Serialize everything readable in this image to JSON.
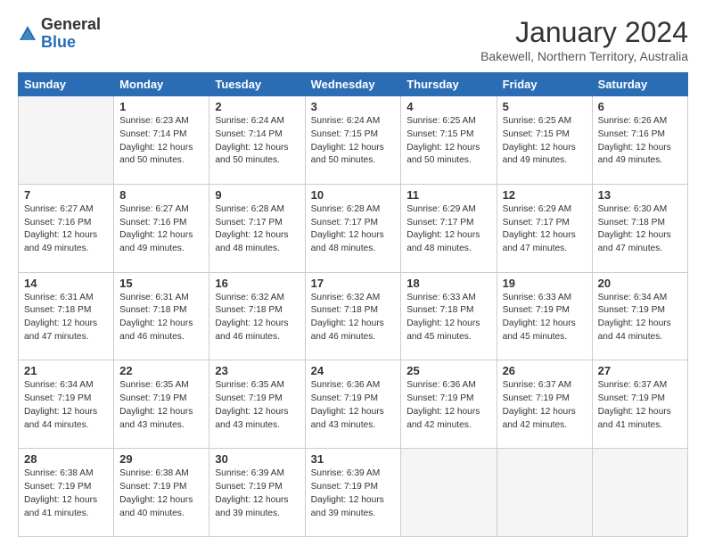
{
  "logo": {
    "general": "General",
    "blue": "Blue"
  },
  "header": {
    "month": "January 2024",
    "location": "Bakewell, Northern Territory, Australia"
  },
  "weekdays": [
    "Sunday",
    "Monday",
    "Tuesday",
    "Wednesday",
    "Thursday",
    "Friday",
    "Saturday"
  ],
  "weeks": [
    [
      {
        "day": "",
        "info": ""
      },
      {
        "day": "1",
        "info": "Sunrise: 6:23 AM\nSunset: 7:14 PM\nDaylight: 12 hours\nand 50 minutes."
      },
      {
        "day": "2",
        "info": "Sunrise: 6:24 AM\nSunset: 7:14 PM\nDaylight: 12 hours\nand 50 minutes."
      },
      {
        "day": "3",
        "info": "Sunrise: 6:24 AM\nSunset: 7:15 PM\nDaylight: 12 hours\nand 50 minutes."
      },
      {
        "day": "4",
        "info": "Sunrise: 6:25 AM\nSunset: 7:15 PM\nDaylight: 12 hours\nand 50 minutes."
      },
      {
        "day": "5",
        "info": "Sunrise: 6:25 AM\nSunset: 7:15 PM\nDaylight: 12 hours\nand 49 minutes."
      },
      {
        "day": "6",
        "info": "Sunrise: 6:26 AM\nSunset: 7:16 PM\nDaylight: 12 hours\nand 49 minutes."
      }
    ],
    [
      {
        "day": "7",
        "info": "Sunrise: 6:27 AM\nSunset: 7:16 PM\nDaylight: 12 hours\nand 49 minutes."
      },
      {
        "day": "8",
        "info": "Sunrise: 6:27 AM\nSunset: 7:16 PM\nDaylight: 12 hours\nand 49 minutes."
      },
      {
        "day": "9",
        "info": "Sunrise: 6:28 AM\nSunset: 7:17 PM\nDaylight: 12 hours\nand 48 minutes."
      },
      {
        "day": "10",
        "info": "Sunrise: 6:28 AM\nSunset: 7:17 PM\nDaylight: 12 hours\nand 48 minutes."
      },
      {
        "day": "11",
        "info": "Sunrise: 6:29 AM\nSunset: 7:17 PM\nDaylight: 12 hours\nand 48 minutes."
      },
      {
        "day": "12",
        "info": "Sunrise: 6:29 AM\nSunset: 7:17 PM\nDaylight: 12 hours\nand 47 minutes."
      },
      {
        "day": "13",
        "info": "Sunrise: 6:30 AM\nSunset: 7:18 PM\nDaylight: 12 hours\nand 47 minutes."
      }
    ],
    [
      {
        "day": "14",
        "info": "Sunrise: 6:31 AM\nSunset: 7:18 PM\nDaylight: 12 hours\nand 47 minutes."
      },
      {
        "day": "15",
        "info": "Sunrise: 6:31 AM\nSunset: 7:18 PM\nDaylight: 12 hours\nand 46 minutes."
      },
      {
        "day": "16",
        "info": "Sunrise: 6:32 AM\nSunset: 7:18 PM\nDaylight: 12 hours\nand 46 minutes."
      },
      {
        "day": "17",
        "info": "Sunrise: 6:32 AM\nSunset: 7:18 PM\nDaylight: 12 hours\nand 46 minutes."
      },
      {
        "day": "18",
        "info": "Sunrise: 6:33 AM\nSunset: 7:18 PM\nDaylight: 12 hours\nand 45 minutes."
      },
      {
        "day": "19",
        "info": "Sunrise: 6:33 AM\nSunset: 7:19 PM\nDaylight: 12 hours\nand 45 minutes."
      },
      {
        "day": "20",
        "info": "Sunrise: 6:34 AM\nSunset: 7:19 PM\nDaylight: 12 hours\nand 44 minutes."
      }
    ],
    [
      {
        "day": "21",
        "info": "Sunrise: 6:34 AM\nSunset: 7:19 PM\nDaylight: 12 hours\nand 44 minutes."
      },
      {
        "day": "22",
        "info": "Sunrise: 6:35 AM\nSunset: 7:19 PM\nDaylight: 12 hours\nand 43 minutes."
      },
      {
        "day": "23",
        "info": "Sunrise: 6:35 AM\nSunset: 7:19 PM\nDaylight: 12 hours\nand 43 minutes."
      },
      {
        "day": "24",
        "info": "Sunrise: 6:36 AM\nSunset: 7:19 PM\nDaylight: 12 hours\nand 43 minutes."
      },
      {
        "day": "25",
        "info": "Sunrise: 6:36 AM\nSunset: 7:19 PM\nDaylight: 12 hours\nand 42 minutes."
      },
      {
        "day": "26",
        "info": "Sunrise: 6:37 AM\nSunset: 7:19 PM\nDaylight: 12 hours\nand 42 minutes."
      },
      {
        "day": "27",
        "info": "Sunrise: 6:37 AM\nSunset: 7:19 PM\nDaylight: 12 hours\nand 41 minutes."
      }
    ],
    [
      {
        "day": "28",
        "info": "Sunrise: 6:38 AM\nSunset: 7:19 PM\nDaylight: 12 hours\nand 41 minutes."
      },
      {
        "day": "29",
        "info": "Sunrise: 6:38 AM\nSunset: 7:19 PM\nDaylight: 12 hours\nand 40 minutes."
      },
      {
        "day": "30",
        "info": "Sunrise: 6:39 AM\nSunset: 7:19 PM\nDaylight: 12 hours\nand 39 minutes."
      },
      {
        "day": "31",
        "info": "Sunrise: 6:39 AM\nSunset: 7:19 PM\nDaylight: 12 hours\nand 39 minutes."
      },
      {
        "day": "",
        "info": ""
      },
      {
        "day": "",
        "info": ""
      },
      {
        "day": "",
        "info": ""
      }
    ]
  ]
}
